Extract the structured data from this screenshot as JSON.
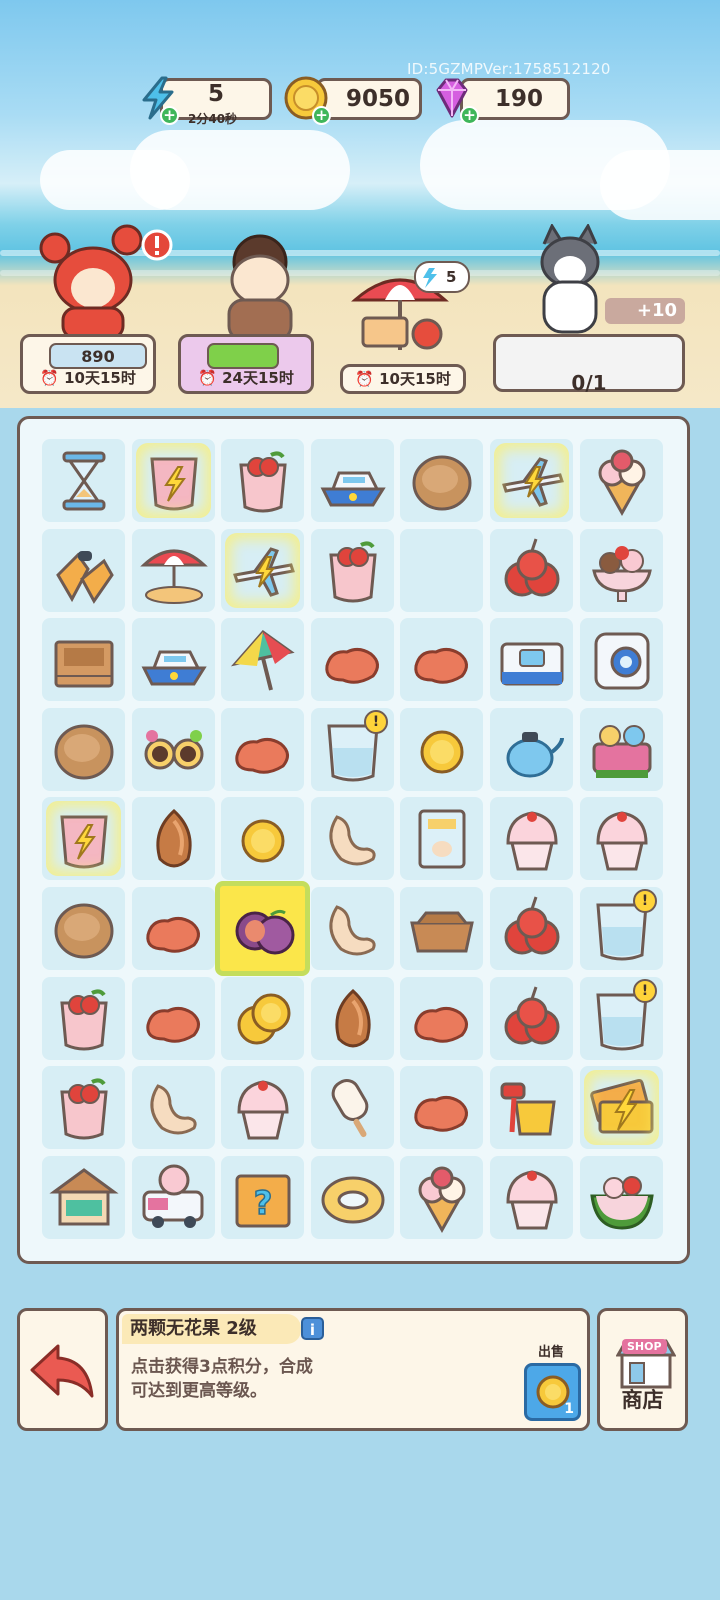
{
  "header": {
    "id_version": "ID:5GZMPVer:1758512120",
    "energy": {
      "value": "5",
      "timer": "2分40秒",
      "icon": "energy-bolt-icon"
    },
    "coins": {
      "value": "9050",
      "icon": "gold-coin-icon"
    },
    "gems": {
      "value": "190",
      "icon": "purple-gem-icon"
    }
  },
  "orders": [
    {
      "character": "crab-costume-cat",
      "reward": "890",
      "time": "10天15时"
    },
    {
      "character": "granny-cat",
      "time": "24天15时"
    },
    {
      "character": "beach-umbrella-event",
      "bubble_count": "5",
      "time": "10天15时"
    },
    {
      "character": "grey-cat",
      "bonus": "+10",
      "progress": "0/1"
    }
  ],
  "board": {
    "rows": [
      [
        "hourglass",
        "glass-lightning",
        "fruit-drink",
        "yacht",
        "coconut",
        "plane-lightning",
        "ice-cream-cone"
      ],
      [
        "flippers",
        "beach-umbrella",
        "plane-lightning",
        "fruit-drink",
        "empty",
        "cherries",
        "sundae"
      ],
      [
        "wooden-crate",
        "yacht",
        "umbrella",
        "peanut",
        "peanut",
        "cooler-box",
        "instant-camera"
      ],
      [
        "coconut",
        "flower-sunglasses",
        "peanut",
        "water-glass-alert",
        "gold-coin",
        "teapot",
        "candy-sign"
      ],
      [
        "glass-lightning",
        "almond",
        "gold-coin",
        "cashew",
        "nut-bag",
        "cupcake",
        "cupcake"
      ],
      [
        "coconut",
        "peanut",
        "fig-selected",
        "cashew",
        "wooden-tray",
        "cherries",
        "water-glass-alert"
      ],
      [
        "fruit-drink",
        "peanut",
        "gold-coins",
        "almond",
        "peanut",
        "cherries",
        "water-glass-alert"
      ],
      [
        "fruit-drink",
        "cashew",
        "cupcake",
        "popsicle",
        "peanut",
        "sand-bucket",
        "tickets-lightning"
      ],
      [
        "beach-hut",
        "ice-cream-truck",
        "mystery-box",
        "swim-ring",
        "ice-cream-cone",
        "cupcake",
        "watermelon-bowl"
      ]
    ]
  },
  "info_panel": {
    "title": "两颗无花果 2级",
    "description_line1": "点击获得3点积分，合成",
    "description_line2": "可达到更高等级。",
    "sell_label": "出售",
    "sell_price": "1"
  },
  "shop": {
    "tag": "SHOP",
    "label": "商店"
  },
  "colors": {
    "border": "#6e5a52",
    "board_bg": "#eef8fb",
    "cell_bg": "#d7eef5",
    "selected": "#fbe64a",
    "accent_green": "#3fb65a"
  }
}
